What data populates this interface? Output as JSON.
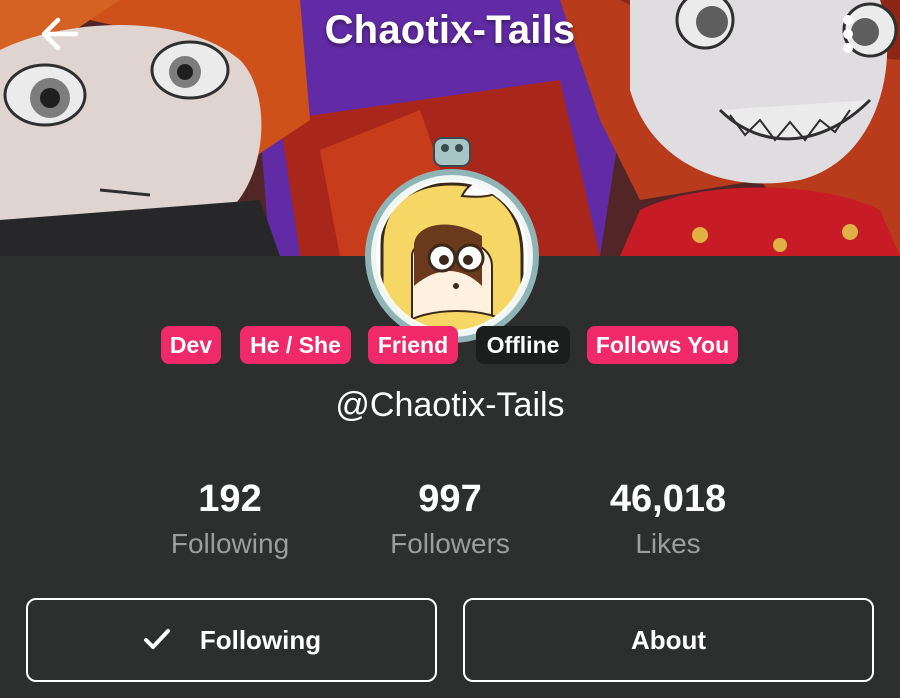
{
  "header": {
    "title": "Chaotix-Tails",
    "back_icon": "arrow-left-icon",
    "more_icon": "more-vertical-icon"
  },
  "badges": [
    "Dev",
    "He / She",
    "Friend",
    "Offline",
    "Follows You"
  ],
  "profile": {
    "handle": "@Chaotix-Tails"
  },
  "stats": {
    "following": {
      "value": "192",
      "label": "Following"
    },
    "followers": {
      "value": "997",
      "label": "Followers"
    },
    "likes": {
      "value": "46,018",
      "label": "Likes"
    }
  },
  "actions": {
    "following_label": "Following",
    "about_label": "About"
  },
  "colors": {
    "background": "#2c2f2e",
    "badge_pink": "#f0296a",
    "badge_dark": "#1c1e1e",
    "muted_text": "#9a9f9e"
  }
}
